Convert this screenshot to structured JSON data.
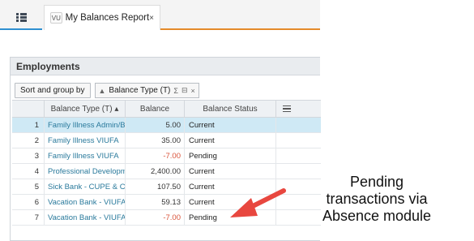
{
  "tabs": {
    "active": {
      "badge": "VU",
      "title": "My Balances Report",
      "close": "×"
    }
  },
  "panel": {
    "title": "Employments",
    "toolbar": {
      "sort_label": "Sort and group by",
      "chip_arrow": "▲",
      "chip_label": "Balance Type (T)",
      "chip_sigma": "Σ",
      "chip_close": "×"
    }
  },
  "table": {
    "columns": {
      "type": "Balance Type (T) ▴",
      "balance": "Balance",
      "status": "Balance Status"
    },
    "rows": [
      {
        "num": "1",
        "type": "Family Illness Admin/B...",
        "balance": "5.00",
        "status": "Current",
        "negative": false,
        "selected": true
      },
      {
        "num": "2",
        "type": "Family Illness VIUFA",
        "balance": "35.00",
        "status": "Current",
        "negative": false,
        "selected": false
      },
      {
        "num": "3",
        "type": "Family Illness VIUFA",
        "balance": "-7.00",
        "status": "Pending",
        "negative": true,
        "selected": false
      },
      {
        "num": "4",
        "type": "Professional Developm...",
        "balance": "2,400.00",
        "status": "Current",
        "negative": false,
        "selected": false
      },
      {
        "num": "5",
        "type": "Sick Bank - CUPE & C...",
        "balance": "107.50",
        "status": "Current",
        "negative": false,
        "selected": false
      },
      {
        "num": "6",
        "type": "Vacation Bank - VIUFA...",
        "balance": "59.13",
        "status": "Current",
        "negative": false,
        "selected": false
      },
      {
        "num": "7",
        "type": "Vacation Bank - VIUFA...",
        "balance": "-7.00",
        "status": "Pending",
        "negative": true,
        "selected": false
      }
    ]
  },
  "annotation": {
    "lines": [
      "Pending",
      "transactions via",
      "Absence module"
    ],
    "color": "#e8473f"
  }
}
